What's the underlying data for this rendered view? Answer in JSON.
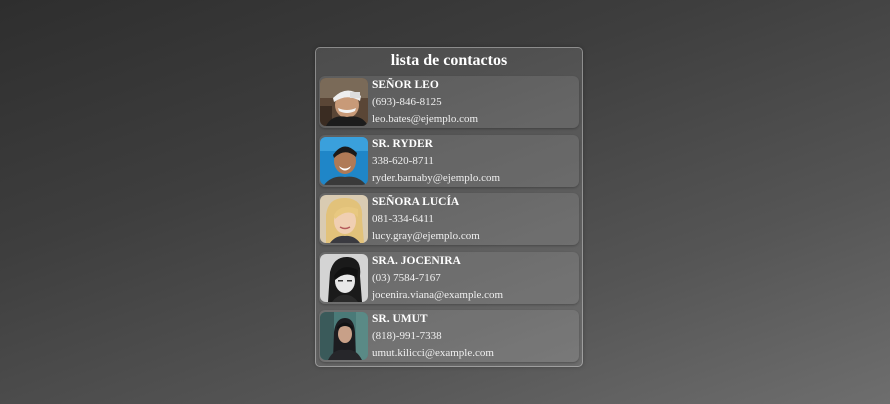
{
  "title": "lista de contactos",
  "contacts": [
    {
      "name": "SEÑOR LEO",
      "phone": "(693)-846-8125",
      "email": "leo.bates@ejemplo.com",
      "avatar": "man-backwards-cap-photo"
    },
    {
      "name": "SR. RYDER",
      "phone": "338-620-8711",
      "email": "ryder.barnaby@ejemplo.com",
      "avatar": "man-smiling-blue-background-photo"
    },
    {
      "name": "SEÑORA LUCÍA",
      "phone": "081-334-6411",
      "email": "lucy.gray@ejemplo.com",
      "avatar": "blonde-woman-photo"
    },
    {
      "name": "SRA. JOCENIRA",
      "phone": "(03) 7584-7167",
      "email": "jocenira.viana@example.com",
      "avatar": "woman-black-hair-bw-photo"
    },
    {
      "name": "SR. UMUT",
      "phone": "(818)-991-7338",
      "email": "umut.kilicci@example.com",
      "avatar": "man-dark-hoodie-photo"
    }
  ],
  "colors": {
    "text": "#ffffff",
    "panel_border": "#9a9a9a",
    "background_dark": "#2e2e2e",
    "background_light": "#6e6e6e"
  }
}
